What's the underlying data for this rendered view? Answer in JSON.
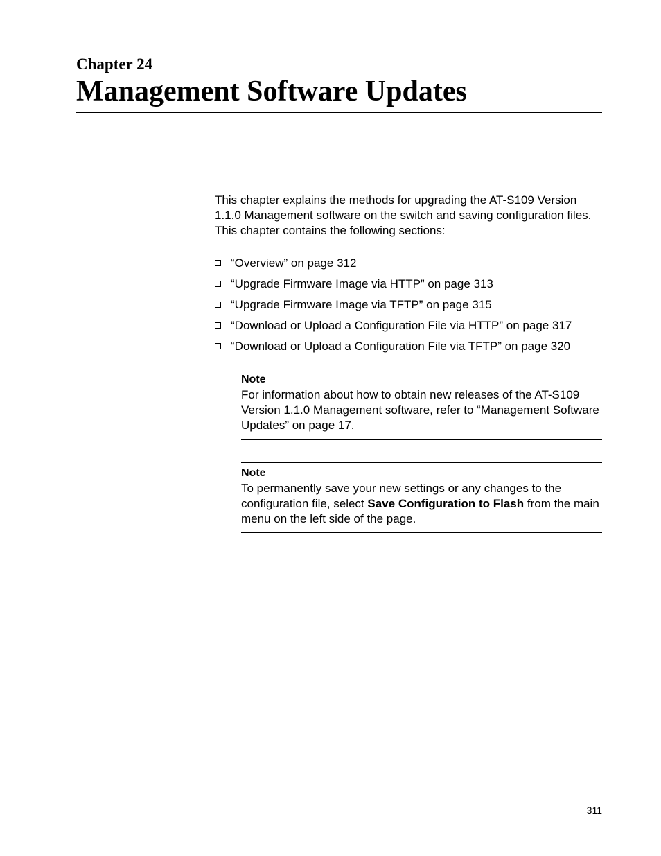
{
  "chapter_label": "Chapter 24",
  "chapter_title": "Management Software Updates",
  "intro": "This chapter explains the methods for upgrading the AT-S109 Version 1.1.0  Management software on the switch and saving configuration files. This chapter contains the following sections:",
  "bullets": [
    "“Overview” on page 312",
    "“Upgrade Firmware Image via HTTP” on page 313",
    "“Upgrade Firmware Image via TFTP” on page 315",
    "“Download or Upload a Configuration File via HTTP” on page 317",
    "“Download or Upload a Configuration File via TFTP” on page 320"
  ],
  "note1": {
    "label": "Note",
    "text": "For information about how to obtain new releases of the AT-S109 Version 1.1.0  Management software, refer to “Management Software Updates” on page 17."
  },
  "note2": {
    "label": "Note",
    "text_before": "To permanently save your new settings or any changes to the configuration file, select ",
    "text_bold": "Save Configuration to Flash",
    "text_after": " from the main menu on the left side of the page."
  },
  "page_number": "311"
}
